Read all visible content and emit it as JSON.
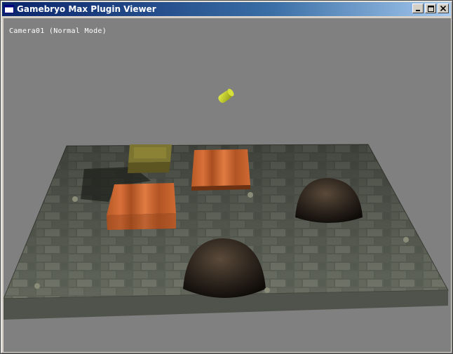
{
  "window": {
    "title": "Gamebryo Max Plugin Viewer",
    "controls": {
      "minimize": "_",
      "maximize": "□",
      "close": "✕"
    }
  },
  "viewport": {
    "camera_label": "Camera01 (Normal Mode)",
    "background_color": "#808080"
  },
  "scene": {
    "objects": [
      "floor",
      "wooden-crate-stack",
      "wooden-crate-back",
      "wooden-crate-front",
      "dome-left",
      "dome-right",
      "yellow-cylinder"
    ]
  },
  "colors": {
    "title_bar_start": "#0a246a",
    "title_bar_end": "#a6caf0",
    "chrome": "#d4d0c8"
  }
}
